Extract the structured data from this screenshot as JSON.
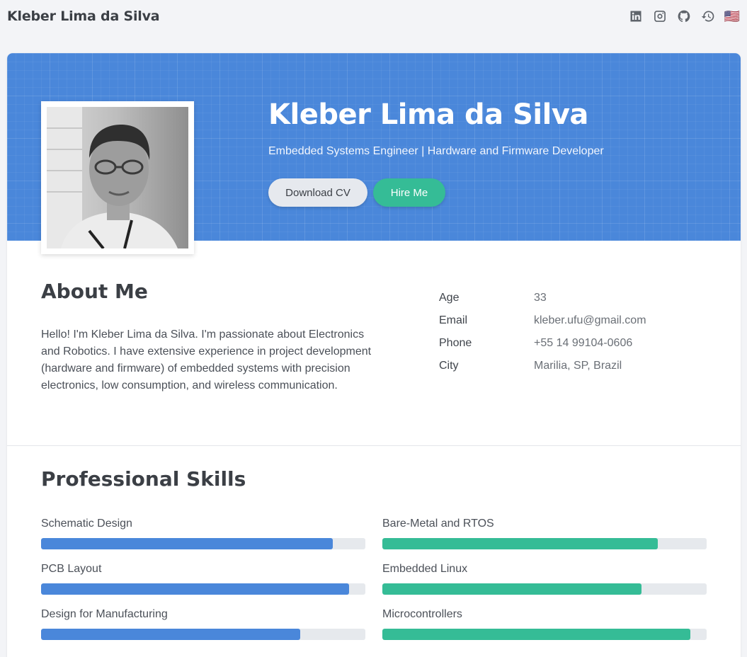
{
  "header": {
    "brand": "Kleber Lima da Silva",
    "icons": [
      "linkedin-icon",
      "instagram-icon",
      "github-icon",
      "history-icon",
      "us-flag-icon"
    ],
    "flag": "🇺🇸"
  },
  "hero": {
    "name": "Kleber Lima da Silva",
    "subtitle": "Embedded Systems Engineer | Hardware and Firmware Developer",
    "download_cv": "Download CV",
    "hire_me": "Hire Me",
    "accent": "#4a87da",
    "secondary": "#35bc96"
  },
  "about": {
    "title": "About Me",
    "text": "Hello! I'm Kleber Lima da Silva. I'm passionate about Electronics and Robotics. I have extensive experience in project development (hardware and firmware) of embedded systems with precision electronics, low consumption, and wireless communication.",
    "info": [
      {
        "label": "Age",
        "value": "33"
      },
      {
        "label": "Email",
        "value": "kleber.ufu@gmail.com"
      },
      {
        "label": "Phone",
        "value": "+55 14 99104-0606"
      },
      {
        "label": "City",
        "value": "Marilia, SP, Brazil"
      }
    ]
  },
  "skills": {
    "title": "Professional Skills",
    "left": [
      {
        "name": "Schematic Design",
        "level": 90
      },
      {
        "name": "PCB Layout",
        "level": 95
      },
      {
        "name": "Design for Manufacturing",
        "level": 80
      }
    ],
    "right": [
      {
        "name": "Bare-Metal and RTOS",
        "level": 85
      },
      {
        "name": "Embedded Linux",
        "level": 80
      },
      {
        "name": "Microcontrollers",
        "level": 95
      }
    ]
  }
}
